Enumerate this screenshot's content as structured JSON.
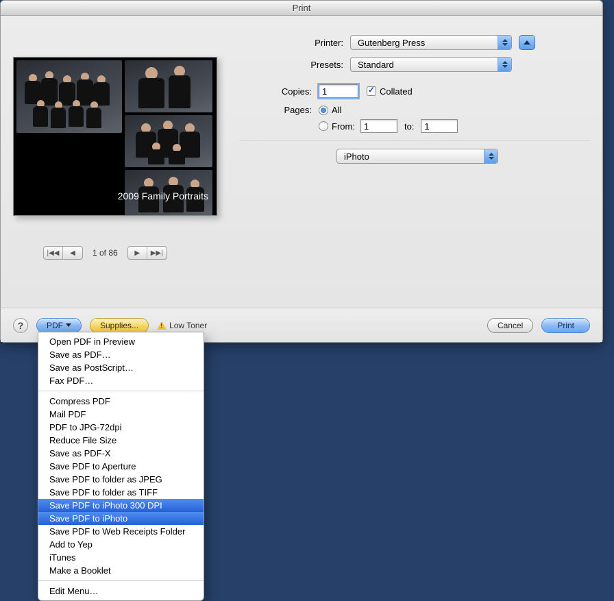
{
  "window": {
    "title": "Print"
  },
  "printer": {
    "label": "Printer:",
    "value": "Gutenberg Press"
  },
  "presets": {
    "label": "Presets:",
    "value": "Standard"
  },
  "copies": {
    "label": "Copies:",
    "value": "1",
    "collated_label": "Collated"
  },
  "pages": {
    "label": "Pages:",
    "all_label": "All",
    "from_label": "From:",
    "to_label": "to:",
    "from_value": "1",
    "to_value": "1"
  },
  "app_select": {
    "value": "iPhoto"
  },
  "preview": {
    "caption": "2009 Family Portraits"
  },
  "pager": {
    "label": "1 of 86"
  },
  "footer": {
    "pdf_label": "PDF",
    "supplies_label": "Supplies...",
    "lowtoner_label": "Low Toner",
    "cancel_label": "Cancel",
    "print_label": "Print"
  },
  "pdf_menu": {
    "group1": [
      "Open PDF in Preview",
      "Save as PDF…",
      "Save as PostScript…",
      "Fax PDF…"
    ],
    "group2": [
      "Compress PDF",
      "Mail PDF",
      "PDF to JPG-72dpi",
      "Reduce File Size",
      "Save as PDF-X",
      "Save PDF to Aperture",
      "Save PDF to folder as JPEG",
      "Save PDF to folder as TIFF",
      "Save PDF to iPhoto 300 DPI",
      "Save PDF to iPhoto",
      "Save PDF to Web Receipts Folder",
      "Add to Yep",
      "iTunes",
      "Make a Booklet"
    ],
    "group3": [
      "Edit Menu…"
    ],
    "highlighted": [
      "Save PDF to iPhoto 300 DPI",
      "Save PDF to iPhoto"
    ]
  }
}
